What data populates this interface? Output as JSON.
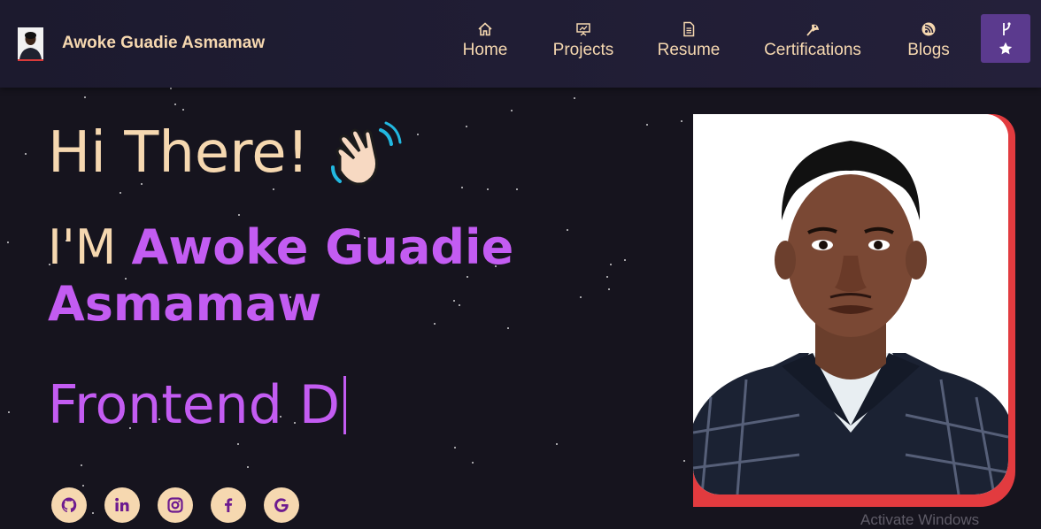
{
  "brand": {
    "name": "Awoke Guadie Asmamaw"
  },
  "nav": {
    "items": [
      {
        "label": "Home",
        "icon": "home-icon"
      },
      {
        "label": "Projects",
        "icon": "projects-icon"
      },
      {
        "label": "Resume",
        "icon": "resume-icon"
      },
      {
        "label": "Certifications",
        "icon": "certifications-icon"
      },
      {
        "label": "Blogs",
        "icon": "blogs-icon"
      }
    ],
    "fork_icons": [
      "git-fork-icon",
      "star-icon"
    ]
  },
  "hero": {
    "greeting": "Hi There!",
    "intro_prefix": "I'M ",
    "name": "Awoke Guadie Asmamaw",
    "typed_text": "Frontend D"
  },
  "social": [
    "github-icon",
    "linkedin-icon",
    "instagram-icon",
    "facebook-icon",
    "google-icon"
  ],
  "watermark": "Activate Windows",
  "colors": {
    "accent": "#c35cf2",
    "cream": "#f6d8b0",
    "background": "#16141e",
    "navbar": "#1c1a2e",
    "fork_button": "#5b3a8e",
    "photo_frame": "#e23b3f"
  }
}
